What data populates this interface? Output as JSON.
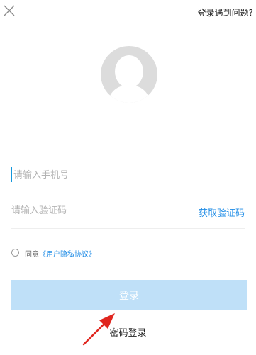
{
  "header": {
    "help_link": "登录遇到问题?"
  },
  "form": {
    "phone_placeholder": "请输入手机号",
    "code_placeholder": "请输入验证码",
    "get_code_label": "获取验证码"
  },
  "agreement": {
    "prefix": "同意",
    "policy_link": "《用户隐私协议》"
  },
  "actions": {
    "login_label": "登录",
    "password_login_label": "密码登录"
  },
  "colors": {
    "accent": "#1f8ce6",
    "login_button": "#bfe0f8",
    "annotation_arrow": "#e0261f"
  },
  "icons": {
    "close": "close-icon",
    "avatar": "default-avatar-icon",
    "arrow": "annotation-arrow-icon"
  }
}
